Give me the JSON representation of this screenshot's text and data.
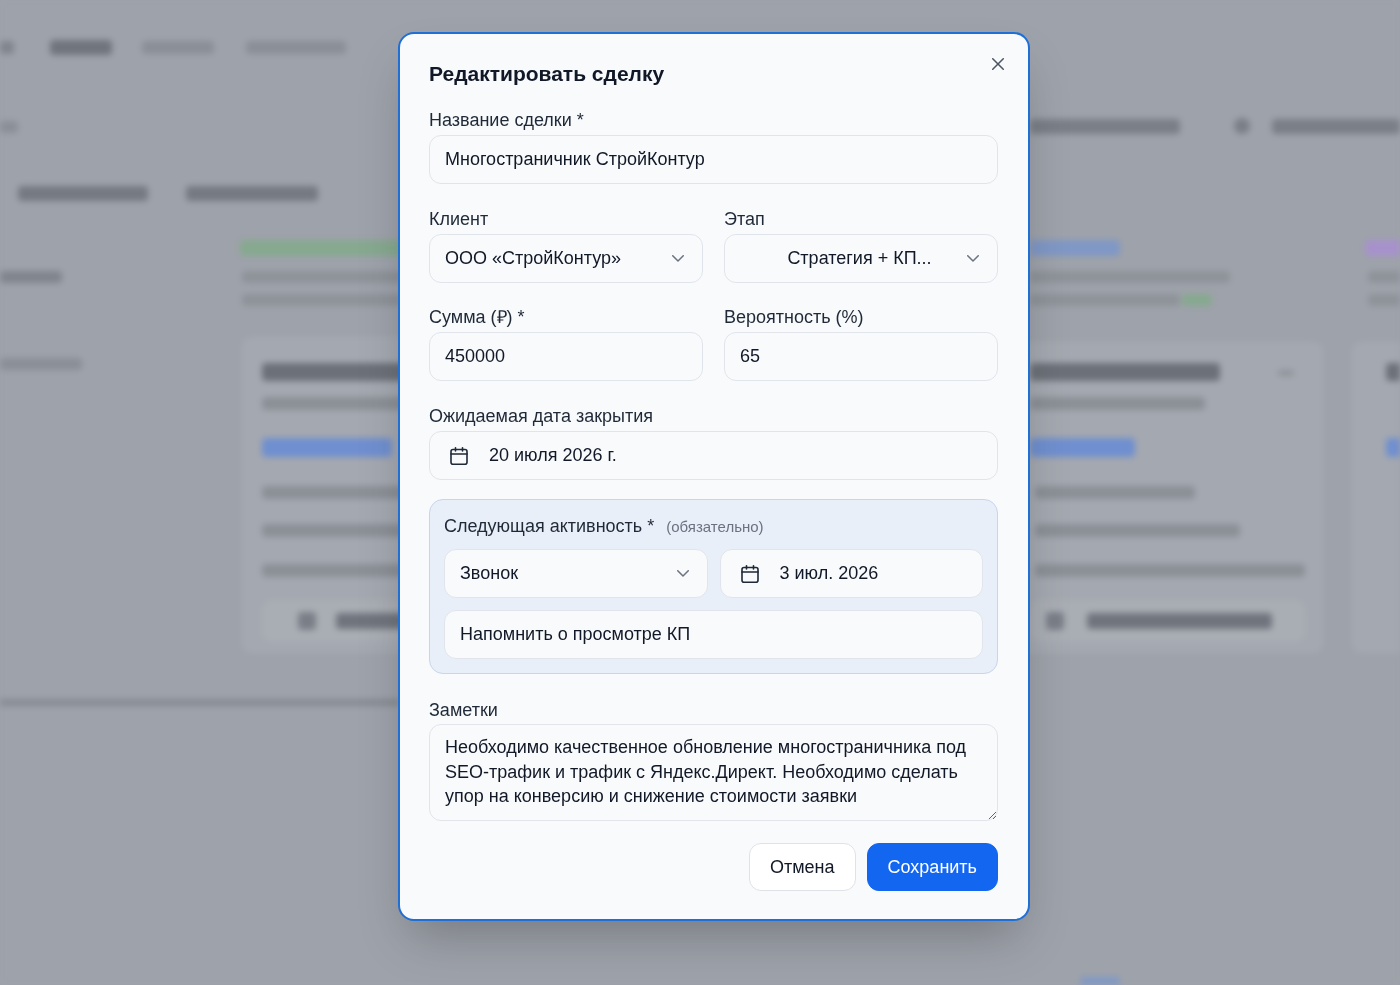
{
  "dialog": {
    "title": "Редактировать сделку",
    "deal_name": {
      "label": "Название сделки *",
      "value": "Многостраничник СтройКонтур"
    },
    "client": {
      "label": "Клиент",
      "value": "ООО «СтройКонтур»"
    },
    "stage": {
      "label": "Этап",
      "value": "Стратегия + КП..."
    },
    "amount": {
      "label": "Сумма (₽) *",
      "value": "450000"
    },
    "probability": {
      "label": "Вероятность (%)",
      "value": "65"
    },
    "close_date": {
      "label": "Ожидаемая дата закрытия",
      "value": "20 июля 2026 г."
    },
    "next_activity": {
      "title": "Следующая активность *",
      "hint": "(обязательно)",
      "type": "Звонок",
      "date": "3 июл. 2026",
      "note": "Напомнить о просмотре КП"
    },
    "notes": {
      "label": "Заметки",
      "value": "Необходимо качественное обновление многостраничника под SEO-трафик и трафик с Яндекс.Директ. Необходимо сделать упор на конверсию и снижение стоимости заявки"
    },
    "buttons": [
      {
        "label": "Отмена",
        "kind": "secondary"
      },
      {
        "label": "Сохранить",
        "kind": "primary"
      }
    ]
  }
}
